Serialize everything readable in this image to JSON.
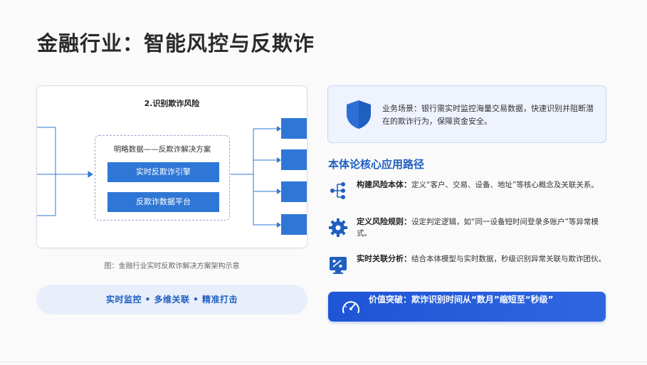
{
  "page": {
    "title": "金融行业：智能风控与反欺诈"
  },
  "diagram": {
    "heading": "2.识别欺诈风险",
    "group_title": "明略数据——反欺诈解决方案",
    "engine_label": "实时反欺诈引擎",
    "platform_label": "反欺诈数据平台",
    "caption": "图：金融行业实时反欺诈解决方案架构示意"
  },
  "tags": {
    "text": "实时监控 • 多维关联 • 精准打击"
  },
  "scenario": {
    "text": "业务场景：银行需实时监控海量交易数据，快速识别并阻断潜在的欺诈行为，保障资金安全。",
    "icon": "shield-icon"
  },
  "path": {
    "heading": "本体论核心应用路径",
    "items": [
      {
        "label": "构建风险本体：",
        "desc": "定义“客户、交易、设备、地址”等核心概念及关联关系。",
        "icon": "network-icon"
      },
      {
        "label": "定义风险规则：",
        "desc": "设定判定逻辑，如“同一设备短时间登录多账户”等异常模式。",
        "icon": "gear-icon"
      },
      {
        "label": "实时关联分析：",
        "desc": "结合本体模型与实时数据，秒级识别异常关联与欺诈团伙。",
        "icon": "analytics-icon"
      }
    ]
  },
  "value": {
    "text": "价值突破：欺诈识别时间从“数月”缩短至“秒级”",
    "icon": "gauge-icon"
  },
  "colors": {
    "accent": "#1f5fc0",
    "block": "#2f77d6",
    "value_bar": "#1e55d6",
    "panel_bg": "#eef3fd"
  }
}
